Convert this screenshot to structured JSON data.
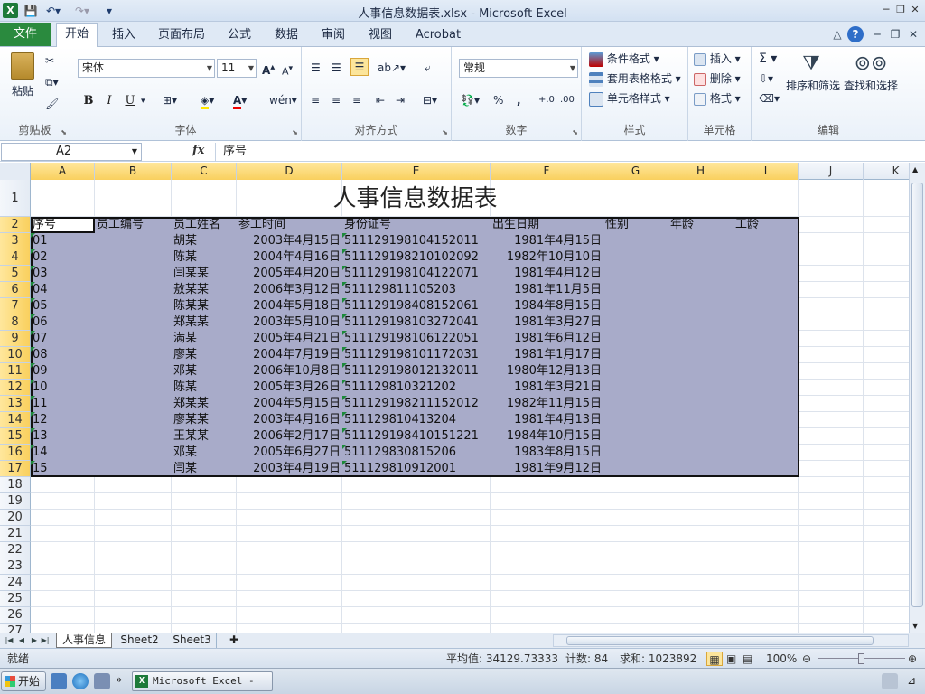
{
  "window": {
    "title": "人事信息数据表.xlsx - Microsoft Excel",
    "app_icon": "X"
  },
  "ribbon_tabs": {
    "file": "文件",
    "items": [
      "开始",
      "插入",
      "页面布局",
      "公式",
      "数据",
      "审阅",
      "视图",
      "Acrobat"
    ],
    "active": "开始"
  },
  "ribbon": {
    "clipboard": {
      "paste": "粘贴",
      "label": "剪贴板"
    },
    "font": {
      "name": "宋体",
      "size": "11",
      "bold": "B",
      "italic": "I",
      "underline": "U",
      "label": "字体"
    },
    "alignment": {
      "label": "对齐方式"
    },
    "number": {
      "format": "常规",
      "percent": "%",
      "comma": ",",
      "inc_decimal": "+.0",
      "dec_decimal": ".00",
      "label": "数字"
    },
    "styles": {
      "conditional": "条件格式",
      "table": "套用表格格式",
      "cell_styles": "单元格样式",
      "label": "样式"
    },
    "cells": {
      "insert": "插入",
      "delete": "删除",
      "format": "格式",
      "label": "单元格"
    },
    "editing": {
      "sum": "Σ",
      "sort_filter": "排序和筛选",
      "find_select": "查找和选择",
      "label": "编辑"
    }
  },
  "formula_bar": {
    "name_box": "A2",
    "fx": "fx",
    "value": "序号"
  },
  "sheet": {
    "columns": [
      "A",
      "B",
      "C",
      "D",
      "E",
      "F",
      "G",
      "H",
      "I",
      "J",
      "K"
    ],
    "row_numbers": [
      "1",
      "2",
      "3",
      "4",
      "5",
      "6",
      "7",
      "8",
      "9",
      "10",
      "11",
      "12",
      "13",
      "14",
      "15",
      "16",
      "17",
      "18",
      "19",
      "20",
      "21",
      "22",
      "23",
      "24",
      "25",
      "26",
      "27"
    ],
    "title": "人事信息数据表",
    "headers": [
      "序号",
      "员工编号",
      "员工姓名",
      "参工时间",
      "身份证号",
      "出生日期",
      "性别",
      "年龄",
      "工龄"
    ],
    "rows": [
      [
        "01",
        "",
        "胡某",
        "2003年4月15日",
        "511129198104152011",
        "1981年4月15日"
      ],
      [
        "02",
        "",
        "陈某",
        "2004年4月16日",
        "511129198210102092",
        "1982年10月10日"
      ],
      [
        "03",
        "",
        "闫某某",
        "2005年4月20日",
        "511129198104122071",
        "1981年4月12日"
      ],
      [
        "04",
        "",
        "敖某某",
        "2006年3月12日",
        "511129811105203",
        "1981年11月5日"
      ],
      [
        "05",
        "",
        "陈某某",
        "2004年5月18日",
        "511129198408152061",
        "1984年8月15日"
      ],
      [
        "06",
        "",
        "郑某某",
        "2003年5月10日",
        "511129198103272041",
        "1981年3月27日"
      ],
      [
        "07",
        "",
        "满某",
        "2005年4月21日",
        "511129198106122051",
        "1981年6月12日"
      ],
      [
        "08",
        "",
        "廖某",
        "2004年7月19日",
        "511129198101172031",
        "1981年1月17日"
      ],
      [
        "09",
        "",
        "邓某",
        "2006年10月8日",
        "511129198012132011",
        "1980年12月13日"
      ],
      [
        "10",
        "",
        "陈某",
        "2005年3月26日",
        "511129810321202",
        "1981年3月21日"
      ],
      [
        "11",
        "",
        "郑某某",
        "2004年5月15日",
        "511129198211152012",
        "1982年11月15日"
      ],
      [
        "12",
        "",
        "廖某某",
        "2003年4月16日",
        "511129810413204",
        "1981年4月13日"
      ],
      [
        "13",
        "",
        "王某某",
        "2006年2月17日",
        "511129198410151221",
        "1984年10月15日"
      ],
      [
        "14",
        "",
        "邓某",
        "2005年6月27日",
        "511129830815206",
        "1983年8月15日"
      ],
      [
        "15",
        "",
        "闫某",
        "2003年4月19日",
        "511129810912001",
        "1981年9月12日"
      ]
    ]
  },
  "sheet_tabs": [
    "人事信息",
    "Sheet2",
    "Sheet3"
  ],
  "active_sheet": "人事信息",
  "status": {
    "mode": "就绪",
    "average": "平均值: 34129.73333",
    "count": "计数: 84",
    "sum": "求和: 1023892",
    "zoom": "100%"
  },
  "taskbar": {
    "start": "开始",
    "excel_task": "Microsoft Excel - ..."
  },
  "colors": {
    "selection": "#a8abc9",
    "file_tab": "#2a8a3e",
    "header_selected": "#f9d05e"
  }
}
